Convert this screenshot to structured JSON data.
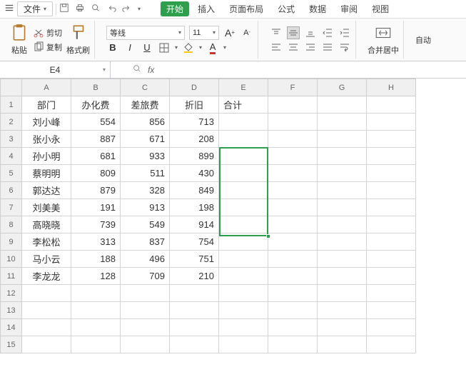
{
  "menubar": {
    "file": "文件",
    "tabs": [
      "开始",
      "插入",
      "页面布局",
      "公式",
      "数据",
      "审阅",
      "视图"
    ]
  },
  "ribbon": {
    "paste": "粘贴",
    "cut": "剪切",
    "copy": "复制",
    "format_painter": "格式刷",
    "font_name": "等线",
    "font_size": "11",
    "merge": "合并居中",
    "auto": "自动"
  },
  "namebox": "E4",
  "cols": [
    "A",
    "B",
    "C",
    "D",
    "E",
    "F",
    "G",
    "H"
  ],
  "rows": [
    "1",
    "2",
    "3",
    "4",
    "5",
    "6",
    "7",
    "8",
    "9",
    "10",
    "11",
    "12",
    "13",
    "14",
    "15"
  ],
  "headers": {
    "A": "部门",
    "B": "办化费",
    "C": "差旅费",
    "D": "折旧",
    "E": "合计"
  },
  "data": [
    {
      "A": "刘小峰",
      "B": "554",
      "C": "856",
      "D": "713"
    },
    {
      "A": "张小永",
      "B": "887",
      "C": "671",
      "D": "208"
    },
    {
      "A": "孙小明",
      "B": "681",
      "C": "933",
      "D": "899"
    },
    {
      "A": "蔡明明",
      "B": "809",
      "C": "511",
      "D": "430"
    },
    {
      "A": "郭达达",
      "B": "879",
      "C": "328",
      "D": "849"
    },
    {
      "A": "刘美美",
      "B": "191",
      "C": "913",
      "D": "198"
    },
    {
      "A": "高晓晓",
      "B": "739",
      "C": "549",
      "D": "914"
    },
    {
      "A": "李松松",
      "B": "313",
      "C": "837",
      "D": "754"
    },
    {
      "A": "马小云",
      "B": "188",
      "C": "496",
      "D": "751"
    },
    {
      "A": "李龙龙",
      "B": "128",
      "C": "709",
      "D": "210"
    }
  ],
  "chart_data": {
    "type": "table",
    "title": "",
    "columns": [
      "部门",
      "办化费",
      "差旅费",
      "折旧",
      "合计"
    ],
    "rows": [
      [
        "刘小峰",
        554,
        856,
        713,
        null
      ],
      [
        "张小永",
        887,
        671,
        208,
        null
      ],
      [
        "孙小明",
        681,
        933,
        899,
        null
      ],
      [
        "蔡明明",
        809,
        511,
        430,
        null
      ],
      [
        "郭达达",
        879,
        328,
        849,
        null
      ],
      [
        "刘美美",
        191,
        913,
        198,
        null
      ],
      [
        "高晓晓",
        739,
        549,
        914,
        null
      ],
      [
        "李松松",
        313,
        837,
        754,
        null
      ],
      [
        "马小云",
        188,
        496,
        751,
        null
      ],
      [
        "李龙龙",
        128,
        709,
        210,
        null
      ]
    ]
  }
}
